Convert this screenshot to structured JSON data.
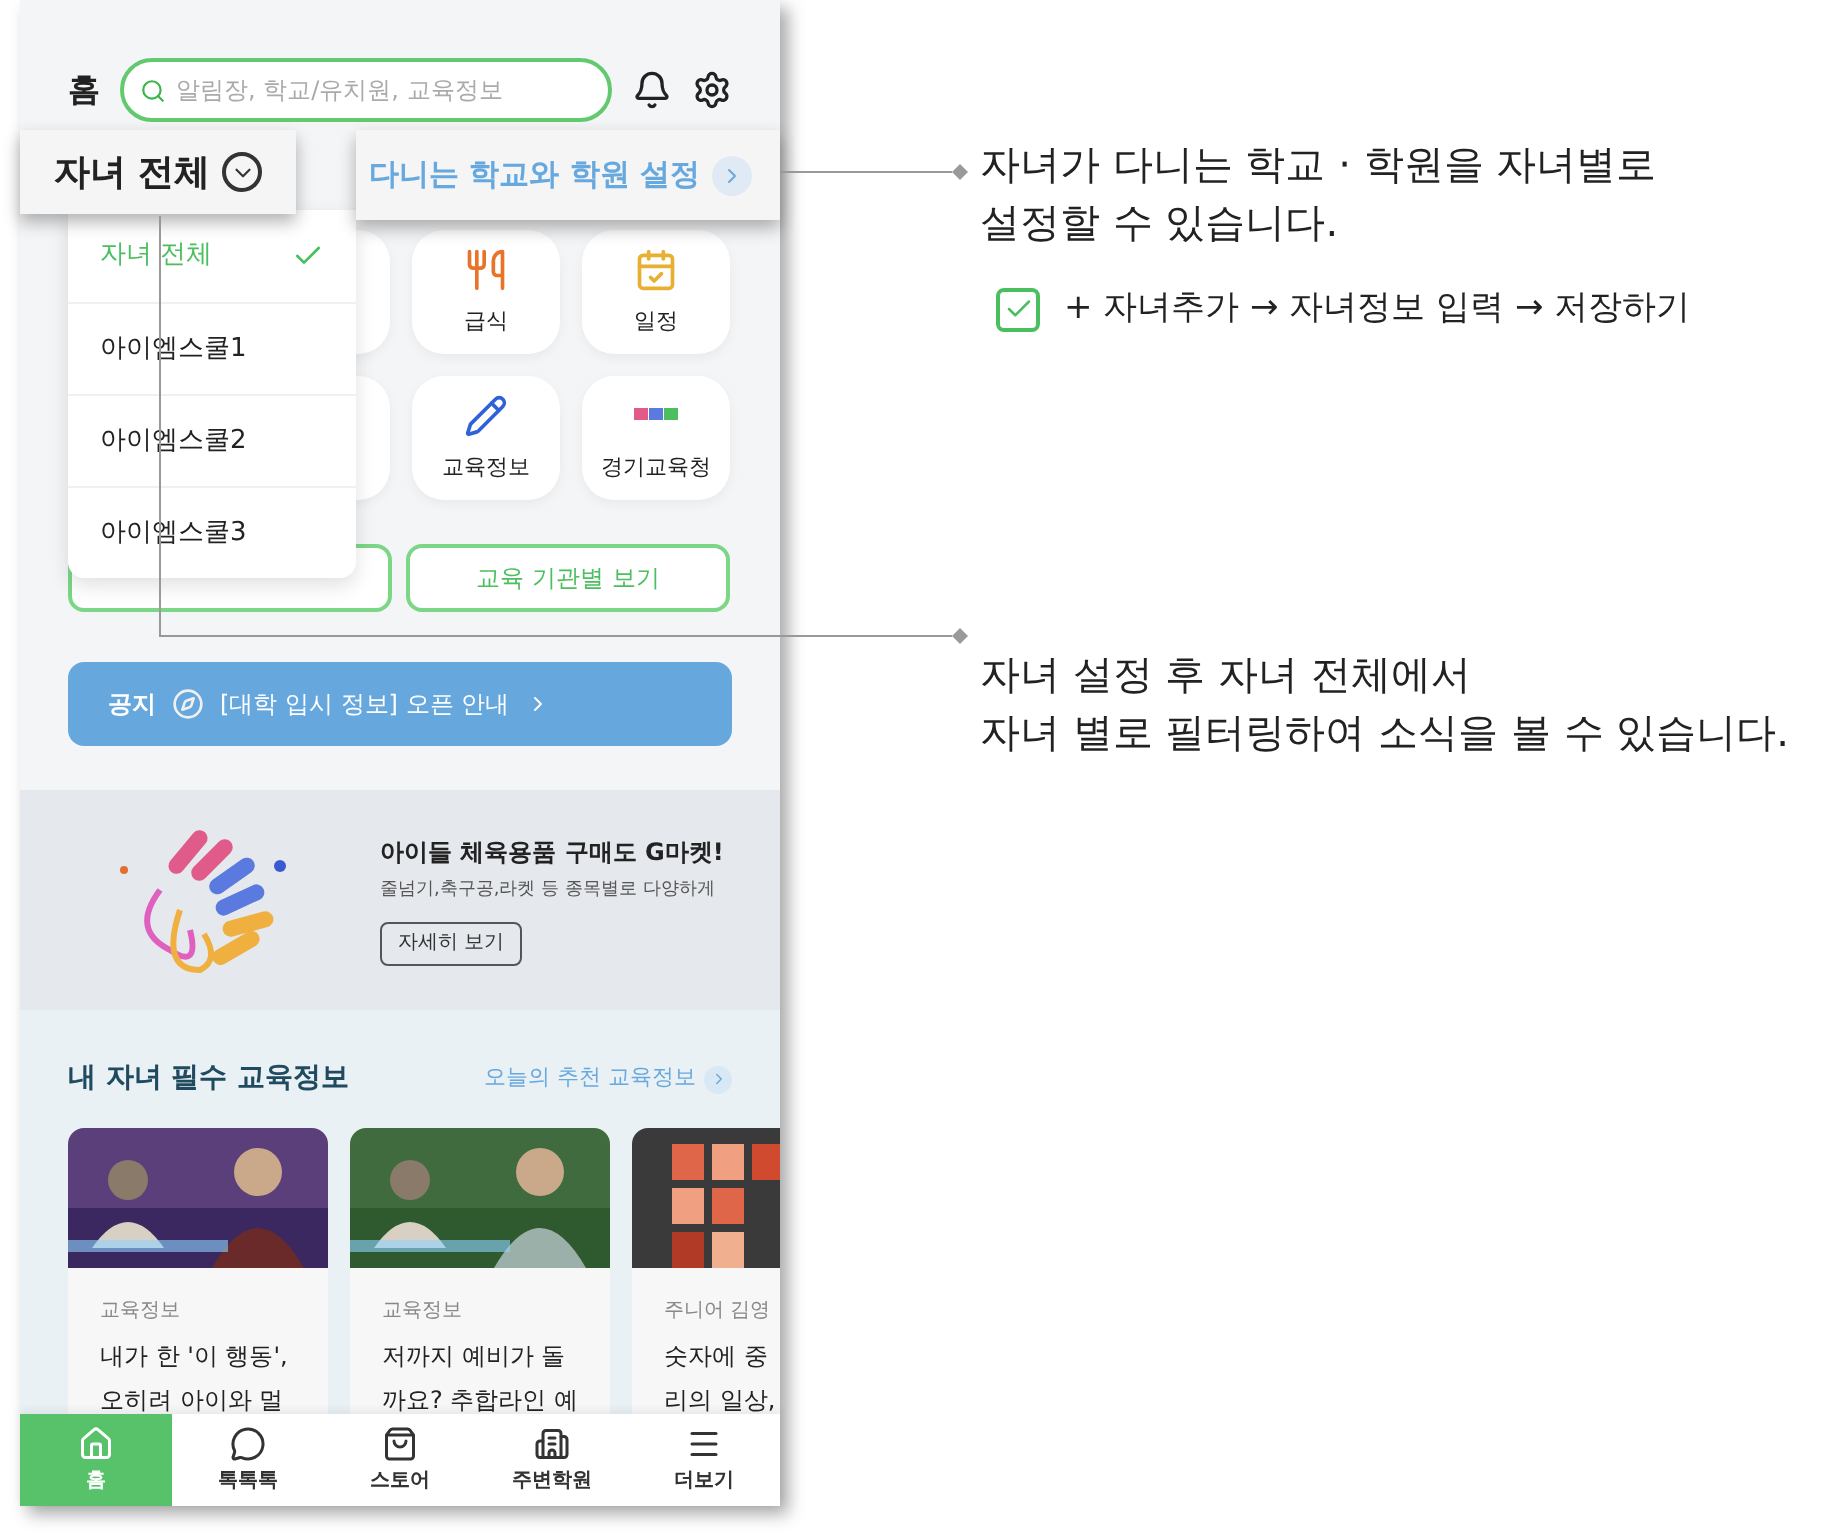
{
  "top_bar": {
    "title": "홈",
    "search": {
      "placeholder": "알림장, 학교/유치원, 교육정보"
    }
  },
  "child_selector": {
    "label": "자녀 전체",
    "expanded": true
  },
  "school_setting": {
    "label": "다니는 학교와 학원 설정"
  },
  "child_menu": [
    {
      "label": "자녀 전체",
      "selected": true
    },
    {
      "label": "아이엠스쿨1",
      "selected": false
    },
    {
      "label": "아이엠스쿨2",
      "selected": false
    },
    {
      "label": "아이엠스쿨3",
      "selected": false
    }
  ],
  "shortcuts": [
    {
      "label": "급식"
    },
    {
      "label": "일정"
    },
    {
      "label": "교육정보"
    },
    {
      "label": "경기교육청"
    }
  ],
  "institution_button": {
    "label": "교육 기관별 보기"
  },
  "notice": {
    "tag": "공지",
    "text": "[대학 입시 정보] 오픈 안내"
  },
  "ad": {
    "title": "아이들 체육용품 구매도 G마켓!",
    "subtitle": "줄넘기,축구공,라켓 등 종목별로 다양하게",
    "button": "자세히 보기"
  },
  "edu_section": {
    "title": "내 자녀 필수 교육정보",
    "link": "오늘의 추천 교육정보",
    "cards": [
      {
        "category": "교육정보",
        "title": "내가 한 '이 행동',\n오히려 아이와 멀"
      },
      {
        "category": "교육정보",
        "title": "저까지 예비가 돌\n까요? 추합라인 예"
      },
      {
        "category": "주니어 김영",
        "title": "숫자에 중\n리의 일상,"
      }
    ]
  },
  "bottom_nav": [
    {
      "label": "홈",
      "selected": true
    },
    {
      "label": "톡톡톡",
      "selected": false
    },
    {
      "label": "스토어",
      "selected": false
    },
    {
      "label": "주변학원",
      "selected": false
    },
    {
      "label": "더보기",
      "selected": false
    }
  ],
  "annotations": [
    {
      "text": "자녀가 다니는 학교 · 학원을 자녀별로\n설정할 수 있습니다.",
      "checklist": [
        {
          "text": "+ 자녀추가 → 자녀정보 입력 → 저장하기",
          "checked": true
        }
      ]
    },
    {
      "text": "자녀 설정 후 자녀 전체에서\n자녀 별로 필터링하여 소식을 볼 수 있습니다."
    }
  ]
}
